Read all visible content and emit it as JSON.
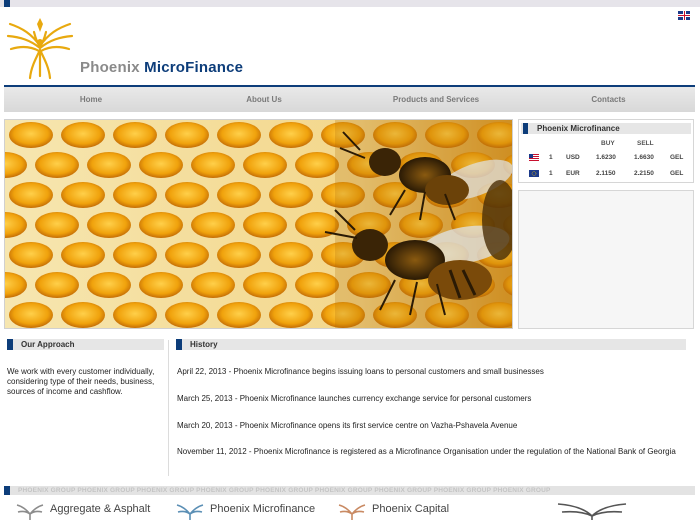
{
  "brand": {
    "name_part1": "Phoenix",
    "name_part2": "MicroFinance"
  },
  "language": {
    "icon": "uk-flag-icon"
  },
  "nav": {
    "items": [
      {
        "label": "Home"
      },
      {
        "label": "About Us"
      },
      {
        "label": "Products and Services"
      },
      {
        "label": "Contacts"
      }
    ]
  },
  "rates": {
    "title": "Phoenix Microfinance",
    "buy_label": "BUY",
    "sell_label": "SELL",
    "rows": [
      {
        "flag": "us-flag-icon",
        "amount": "1",
        "currency": "USD",
        "buy": "1.6230",
        "sell": "1.6630",
        "target": "GEL"
      },
      {
        "flag": "eu-flag-icon",
        "amount": "1",
        "currency": "EUR",
        "buy": "2.1150",
        "sell": "2.2150",
        "target": "GEL"
      }
    ]
  },
  "approach": {
    "title": "Our Approach",
    "text": "We work with every customer individually, considering type of their needs, business, sources of income and cashflow."
  },
  "history": {
    "title": "History",
    "items": [
      "April 22, 2013 - Phoenix Microfinance begins issuing loans to personal customers and small businesses",
      "March 25, 2013 - Phoenix Microfinance launches currency exchange service for personal customers",
      "March 20, 2013 - Phoenix Microfinance opens its first service centre on Vazha-Pshavela Avenue",
      "November 11, 2012 - Phoenix Microfinance is registered as a Microfinance Organisation under the regulation of the National Bank of Georgia"
    ]
  },
  "footer": {
    "group_label": "PHOENIX GROUP",
    "partners": [
      "Aggregate & Asphalt",
      "Phoenix Microfinance",
      "Phoenix Capital"
    ]
  },
  "colors": {
    "accent": "#0d3d7a",
    "gold": "#e8a90f"
  }
}
